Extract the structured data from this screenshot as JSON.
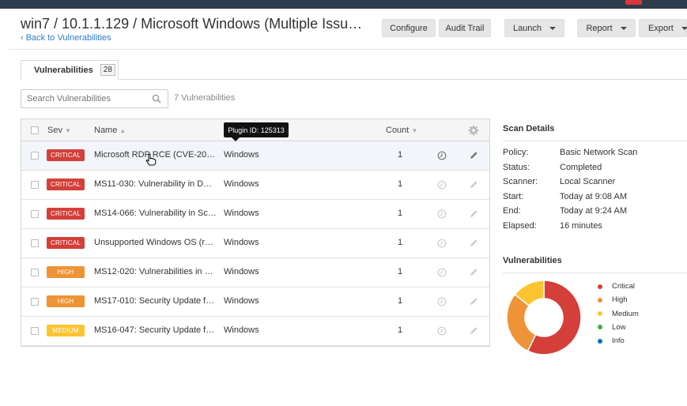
{
  "page": {
    "title": "win7 / 10.1.1.129 / Microsoft Windows (Multiple Issu…",
    "back_link": "‹ Back to Vulnerabilities"
  },
  "toolbar": {
    "configure": "Configure",
    "audit_trail": "Audit Trail",
    "launch": "Launch",
    "report": "Report",
    "export": "Export"
  },
  "tabs": [
    {
      "label": "Vulnerabilities",
      "count": "28"
    }
  ],
  "search": {
    "placeholder": "Search Vulnerabilities"
  },
  "result_count": "7 Vulnerabilities",
  "table": {
    "columns": {
      "sev": "Sev",
      "name": "Name",
      "family": "",
      "count": "Count"
    },
    "rows": [
      {
        "severity": "CRITICAL",
        "name": "Microsoft RDP RCE (CVE-20…",
        "family": "Windows",
        "count": "1"
      },
      {
        "severity": "CRITICAL",
        "name": "MS11-030: Vulnerability in D…",
        "family": "Windows",
        "count": "1"
      },
      {
        "severity": "CRITICAL",
        "name": "MS14-066: Vulnerability in Sc…",
        "family": "Windows",
        "count": "1"
      },
      {
        "severity": "CRITICAL",
        "name": "Unsupported Windows OS (r…",
        "family": "Windows",
        "count": "1"
      },
      {
        "severity": "HIGH",
        "name": "MS12-020: Vulnerabilities in …",
        "family": "Windows",
        "count": "1"
      },
      {
        "severity": "HIGH",
        "name": "MS17-010: Security Update f…",
        "family": "Windows",
        "count": "1"
      },
      {
        "severity": "MEDIUM",
        "name": "MS16-047: Security Update f…",
        "family": "Windows",
        "count": "1"
      }
    ]
  },
  "tooltip": "Plugin ID: 125313",
  "scan_details": {
    "title": "Scan Details",
    "items": [
      {
        "label": "Policy:",
        "value": "Basic Network Scan"
      },
      {
        "label": "Status:",
        "value": "Completed"
      },
      {
        "label": "Scanner:",
        "value": "Local Scanner"
      },
      {
        "label": "Start:",
        "value": "Today at 9:08 AM"
      },
      {
        "label": "End:",
        "value": "Today at 9:24 AM"
      },
      {
        "label": "Elapsed:",
        "value": "16 minutes"
      }
    ]
  },
  "vuln_chart": {
    "title": "Vulnerabilities",
    "legend": [
      {
        "label": "Critical",
        "color": "#d43f3a"
      },
      {
        "label": "High",
        "color": "#ee9336"
      },
      {
        "label": "Medium",
        "color": "#fdc431"
      },
      {
        "label": "Low",
        "color": "#3fae49"
      },
      {
        "label": "Info",
        "color": "#0071b9"
      }
    ]
  },
  "chart_data": {
    "type": "pie",
    "categories": [
      "Critical",
      "High",
      "Medium",
      "Low",
      "Info"
    ],
    "values": [
      4,
      2,
      1,
      0,
      0
    ],
    "colors": [
      "#d43f3a",
      "#ee9336",
      "#fdc431",
      "#3fae49",
      "#0071b9"
    ]
  },
  "colors": {
    "critical": "#d43f3a",
    "high": "#ee9336",
    "medium": "#fdc431",
    "link": "#2e7dc6"
  }
}
